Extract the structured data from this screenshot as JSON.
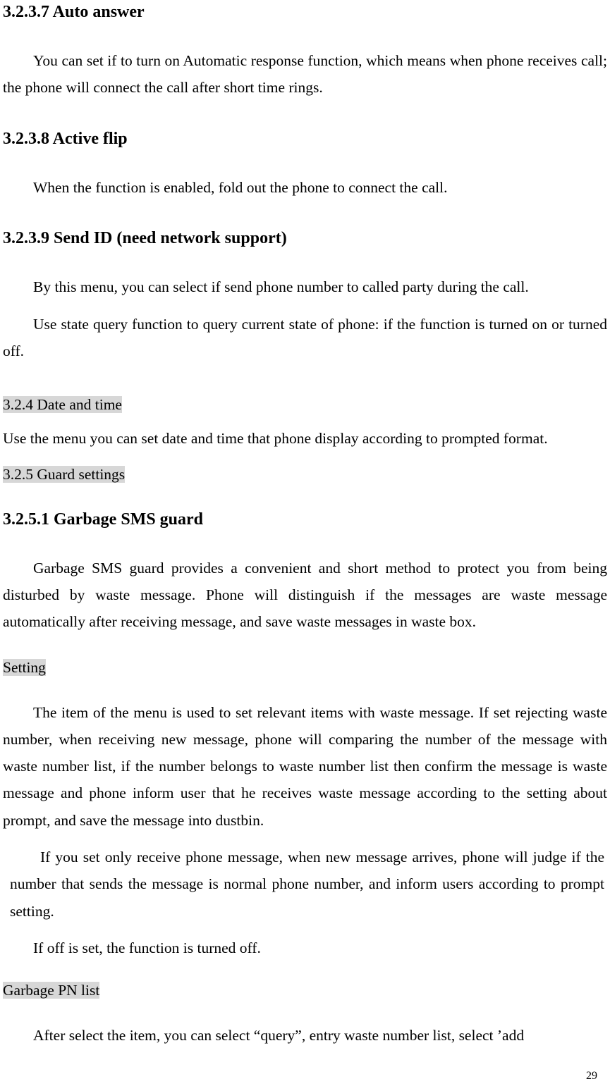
{
  "sections": {
    "s1": {
      "heading": "3.2.3.7 Auto answer",
      "p1": "You can set if to turn on Automatic response function, which means when phone receives call; the phone will connect the call after short time rings."
    },
    "s2": {
      "heading": "3.2.3.8 Active flip",
      "p1": "When the function is enabled, fold out the phone to connect the call."
    },
    "s3": {
      "heading": "3.2.3.9 Send ID (need network support)",
      "p1": "By this menu, you can select if send phone number to called party during the call.",
      "p2": "Use state query function to query current state of phone: if the function is turned on or turned off."
    },
    "s4": {
      "hl": "3.2.4 Date and time",
      "p1": "Use the menu you can set date and time that phone display according to prompted format."
    },
    "s5": {
      "hl": "3.2.5 Guard settings"
    },
    "s6": {
      "heading": "3.2.5.1 Garbage SMS guard",
      "p1": "Garbage SMS guard provides a convenient and short method to protect you from being disturbed by waste message. Phone will distinguish if the messages are waste message automatically after receiving message, and save waste messages in waste box.",
      "hlSetting": "Setting",
      "p2": "The item of the menu is used to set relevant items with waste message. If set rejecting waste number, when receiving new message, phone will comparing the number of the message with waste number list, if the number belongs to waste number list then confirm the message is waste message and phone inform user that he receives waste message according to the setting about prompt, and save the message into dustbin.",
      "p3": "If you set only receive phone message, when new message arrives, phone will judge if the number that sends the message is normal phone number, and inform users according to prompt setting.",
      "p4": "If off is set, the function is turned off.",
      "hlGarbage": "Garbage PN list  ",
      "p5": "After select the item, you can select “query”, entry waste number list, select ’add"
    }
  },
  "pageNumber": "29"
}
